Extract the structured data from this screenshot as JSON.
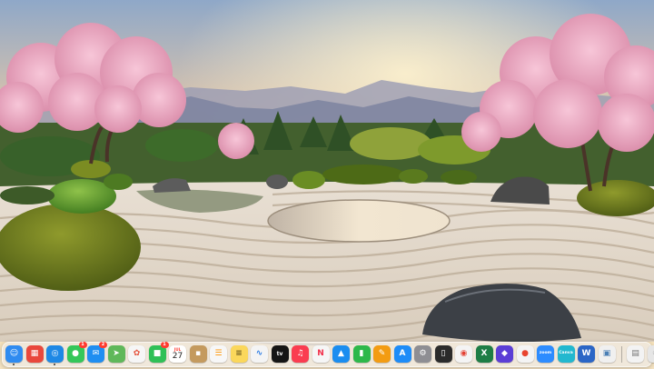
{
  "desktop": {
    "wallpaper": "japanese-zen-garden-with-cherry-blossoms"
  },
  "dock": {
    "apps": [
      {
        "name": "finder",
        "icon": "finder-icon",
        "glyph": "☺",
        "bg": "#2f8bf0",
        "running": true
      },
      {
        "name": "launchpad",
        "icon": "launchpad-icon",
        "glyph": "▦",
        "bg": "#e9473c"
      },
      {
        "name": "safari",
        "icon": "safari-icon",
        "glyph": "◎",
        "bg": "#1e88e5",
        "running": true
      },
      {
        "name": "messages",
        "icon": "messages-icon",
        "glyph": "●",
        "bg": "#34c759",
        "badge": "1"
      },
      {
        "name": "mail",
        "icon": "mail-icon",
        "glyph": "✉",
        "bg": "#1f8ef1",
        "badge": "2"
      },
      {
        "name": "maps",
        "icon": "maps-icon",
        "glyph": "➤",
        "bg": "#5fb85a"
      },
      {
        "name": "photos",
        "icon": "photos-icon",
        "glyph": "✿",
        "bg": "#f6f6f6",
        "fg": "#e5533c"
      },
      {
        "name": "facetime",
        "icon": "facetime-icon",
        "glyph": "■",
        "bg": "#2fc057",
        "badge": "1"
      },
      {
        "name": "calendar",
        "icon": "calendar-icon",
        "type": "calendar",
        "month": "JUL",
        "day": "27",
        "bg": "#ffffff"
      },
      {
        "name": "contacts",
        "icon": "contacts-icon",
        "glyph": "▪",
        "bg": "#c49a5e"
      },
      {
        "name": "reminders",
        "icon": "reminders-icon",
        "glyph": "☰",
        "bg": "#f7f7f7",
        "fg": "#ff9500"
      },
      {
        "name": "notes",
        "icon": "notes-icon",
        "glyph": "≡",
        "bg": "#fbd75b",
        "fg": "#6b5a20"
      },
      {
        "name": "freeform",
        "icon": "freeform-icon",
        "glyph": "∿",
        "bg": "#f4f4f4",
        "fg": "#2a7be4"
      },
      {
        "name": "apple-tv",
        "icon": "tv-icon",
        "glyph": "tv",
        "bg": "#151515"
      },
      {
        "name": "music",
        "icon": "music-icon",
        "glyph": "♫",
        "bg": "#fa3c50"
      },
      {
        "name": "news",
        "icon": "news-icon",
        "glyph": "N",
        "bg": "#f6f6f6",
        "fg": "#f2304a"
      },
      {
        "name": "keynote",
        "icon": "keynote-icon",
        "glyph": "▲",
        "bg": "#1a8df0"
      },
      {
        "name": "numbers",
        "icon": "numbers-icon",
        "glyph": "▮",
        "bg": "#2db84a"
      },
      {
        "name": "pages",
        "icon": "pages-icon",
        "glyph": "✎",
        "bg": "#f39c12"
      },
      {
        "name": "app-store",
        "icon": "app-store-icon",
        "glyph": "A",
        "bg": "#1d8cf8"
      },
      {
        "name": "system-settings",
        "icon": "gear-icon",
        "glyph": "⚙",
        "bg": "#8e8e93"
      },
      {
        "name": "iphone-mirroring",
        "icon": "iphone-icon",
        "glyph": "▯",
        "bg": "#2b2b2b"
      },
      {
        "name": "chrome",
        "icon": "chrome-icon",
        "glyph": "◉",
        "bg": "#f4f4f4",
        "fg": "#e34133"
      },
      {
        "name": "excel",
        "icon": "excel-icon",
        "glyph": "X",
        "bg": "#1e7d45"
      },
      {
        "name": "app-purple",
        "icon": "purple-app-icon",
        "glyph": "◆",
        "bg": "#5b3ed6"
      },
      {
        "name": "app-red",
        "icon": "red-app-icon",
        "glyph": "●",
        "bg": "#f4f4f4",
        "fg": "#e8442e"
      },
      {
        "name": "zoom",
        "icon": "zoom-icon",
        "glyph": "zoom",
        "bg": "#2d8cff"
      },
      {
        "name": "canva",
        "icon": "canva-icon",
        "glyph": "Canva",
        "bg": "#22b8cf"
      },
      {
        "name": "word",
        "icon": "word-icon",
        "glyph": "W",
        "bg": "#2b66c6"
      },
      {
        "name": "preview",
        "icon": "preview-icon",
        "glyph": "▣",
        "bg": "#f0f0f0",
        "fg": "#4a7fb5"
      },
      {
        "name": "documents",
        "icon": "documents-icon",
        "glyph": "▤",
        "bg": "#f3f3f3",
        "fg": "#777",
        "separatorBefore": true
      },
      {
        "name": "trash",
        "icon": "trash-icon",
        "glyph": "♲",
        "bg": "#e6e6e6",
        "fg": "#777"
      }
    ]
  }
}
